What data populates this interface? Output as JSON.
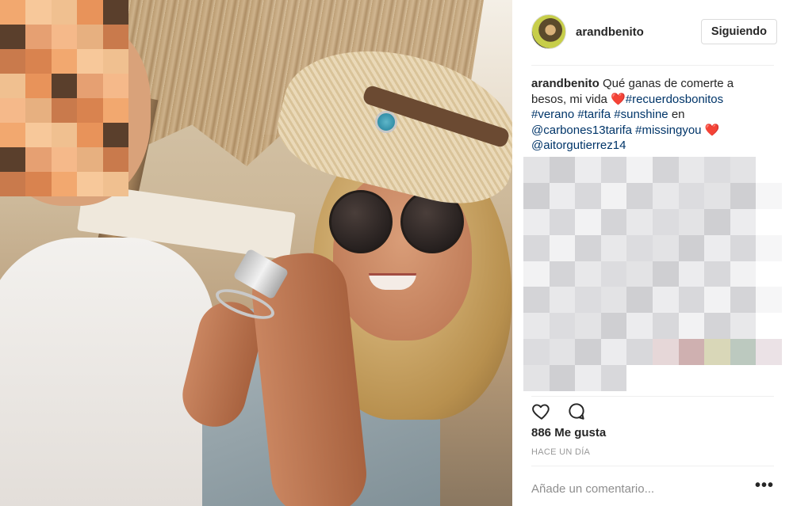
{
  "post": {
    "username": "arandbenito",
    "follow_button": "Siguiendo",
    "caption": {
      "username": "arandbenito",
      "text_1": "Qué ganas de comerte a besos, mi vida ",
      "heart_1": "❤️",
      "tag_recuerdos": "#recuerdosbonitos",
      "tag_verano": "#verano",
      "tag_tarifa": "#tarifa",
      "tag_sunshine": "#sunshine",
      "text_en": "en",
      "mention_carbones": "@carbones13tarifa",
      "tag_missing": "#missingyou",
      "heart_2": "❤️",
      "mention_aitor": "@aitorgutierrez14"
    },
    "likes": "886 Me gusta",
    "time_ago": "HACE UN DÍA",
    "comment_placeholder": "Añade un comentario...",
    "more_options": "•••"
  },
  "icons": {
    "like": "heart-outline-icon",
    "comment": "comment-bubble-icon",
    "options": "more-horizontal-icon"
  },
  "colors": {
    "hashtag": "#003569",
    "text": "#262626",
    "secondary": "#999999",
    "border": "#dbdbdb"
  }
}
